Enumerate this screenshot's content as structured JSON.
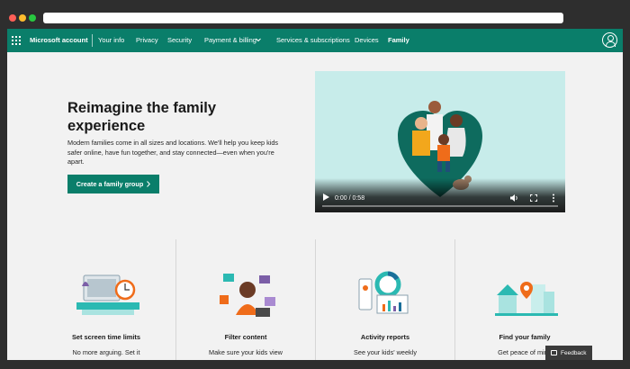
{
  "colors": {
    "nav_bg": "#0a7e6a",
    "page_bg": "#f2f2f2",
    "video_bg": "#c7ecea",
    "text": "#1a1a1a"
  },
  "nav": {
    "brand": "Microsoft account",
    "items": [
      "Your info",
      "Privacy",
      "Security",
      "Payment & billing",
      "Services & subscriptions",
      "Devices",
      "Family"
    ],
    "active": "Family",
    "icons": {
      "apps": "waffle-icon",
      "payment_dropdown": "chevron-down-icon",
      "profile": "profile-icon"
    }
  },
  "hero": {
    "title": "Reimagine the family experience",
    "description": "Modern families come in all sizes and locations. We'll help you keep kids safer online, have fun together, and stay connected—even when you're apart.",
    "cta_label": "Create a family group",
    "cta_icon": "chevron-right-icon"
  },
  "video": {
    "time": "0:00 / 0:58",
    "progress": 0
  },
  "features": [
    {
      "title": "Set screen time limits",
      "description": "No more arguing. Set it",
      "icon": "computer-clock-icon"
    },
    {
      "title": "Filter content",
      "description": "Make sure your kids view",
      "icon": "kid-content-icon"
    },
    {
      "title": "Activity reports",
      "description": "See your kids' weekly",
      "icon": "reports-chart-icon"
    },
    {
      "title": "Find your family",
      "description": "Get peace of mind",
      "icon": "map-pin-house-icon"
    }
  ],
  "feedback": {
    "label": "Feedback",
    "icon": "chat-icon"
  }
}
